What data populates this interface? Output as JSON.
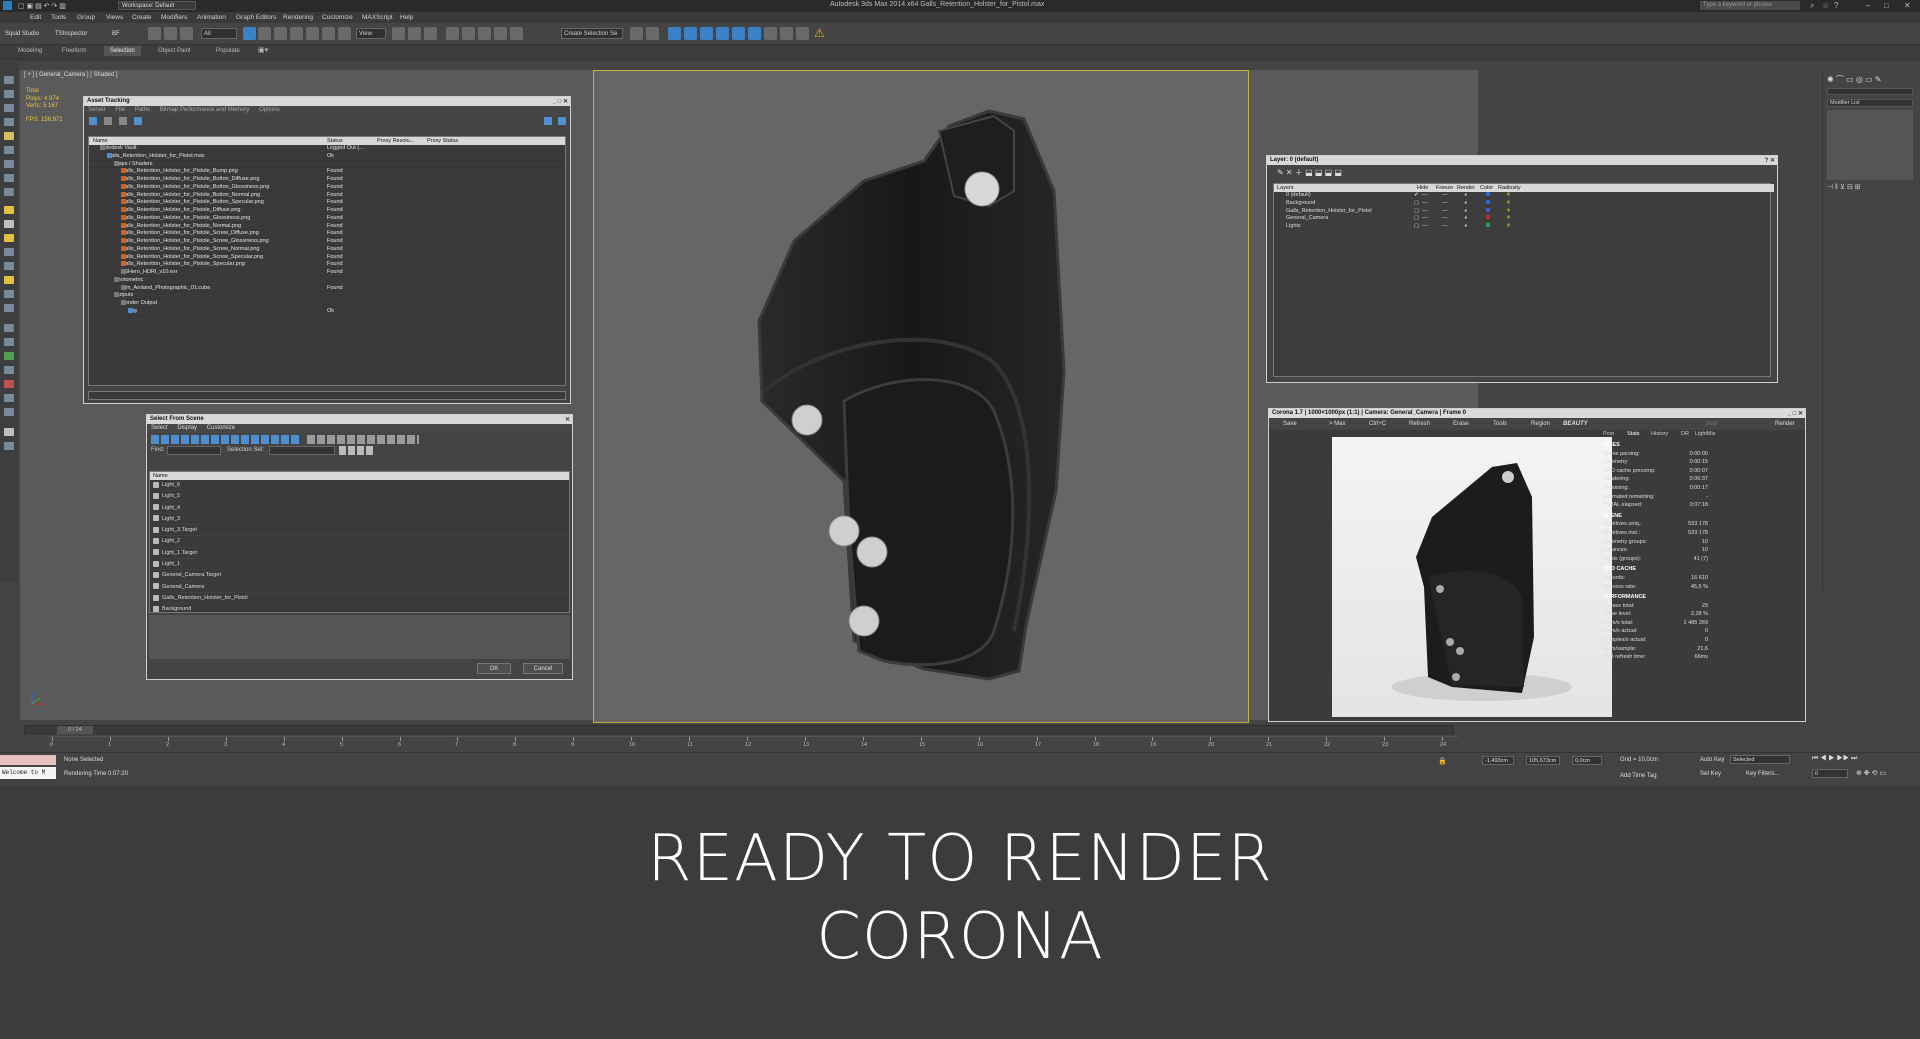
{
  "window": {
    "title": "Autodesk 3ds Max 2014 x64     Galls_Retention_Holster_for_Pistol.max",
    "workspace": "Workspace: Default",
    "search_placeholder": "Type a keyword or phrase"
  },
  "menubar": [
    "Edit",
    "Tools",
    "Group",
    "Views",
    "Create",
    "Modifiers",
    "Animation",
    "Graph Editors",
    "Rendering",
    "Customize",
    "MAXScript",
    "Help"
  ],
  "toolbar": {
    "left_labels": [
      "Squid Studio",
      "TSInspector",
      "BF"
    ],
    "filter_select": "All",
    "view_select": "View",
    "selection_set": "Create Selection Se"
  },
  "ribbon_tabs": [
    "Modeling",
    "Freeform",
    "Selection",
    "Object Paint",
    "Populate"
  ],
  "ribbon_active": "Selection",
  "viewport": {
    "label": "[ + ] [ General_Camera ] [ Shaded ]",
    "stats": {
      "total": "Total",
      "polys": "Polys:   4 974",
      "verts": "Verts:   5 167",
      "fps": "FPS:     156,971"
    }
  },
  "asset_tracking": {
    "title": "Asset Tracking",
    "menu": [
      "Server",
      "File",
      "Paths",
      "Bitmap Performance and Memory",
      "Options"
    ],
    "columns": [
      "Name",
      "Status",
      "Proxy Resolu...",
      "Proxy Status"
    ],
    "rows": [
      {
        "name": "Autodesk Vault",
        "status": "Logged Out (...",
        "indent": 1,
        "icon": "g"
      },
      {
        "name": "Galls_Retention_Holster_for_Pistol.max",
        "status": "Ok",
        "indent": 2,
        "icon": "b"
      },
      {
        "name": "Maps / Shaders",
        "status": "",
        "indent": 3,
        "icon": "g"
      },
      {
        "name": "Galls_Retention_Holster_for_Pistole_Bump.png",
        "status": "Found",
        "indent": 4,
        "icon": "o"
      },
      {
        "name": "Galls_Retention_Holster_for_Pistole_Button_Diffuse.png",
        "status": "Found",
        "indent": 4,
        "icon": "o"
      },
      {
        "name": "Galls_Retention_Holster_for_Pistole_Button_Glossiness.png",
        "status": "Found",
        "indent": 4,
        "icon": "o"
      },
      {
        "name": "Galls_Retention_Holster_for_Pistole_Button_Normal.png",
        "status": "Found",
        "indent": 4,
        "icon": "o"
      },
      {
        "name": "Galls_Retention_Holster_for_Pistole_Button_Specular.png",
        "status": "Found",
        "indent": 4,
        "icon": "o"
      },
      {
        "name": "Galls_Retention_Holster_for_Pistole_Diffuse.png",
        "status": "Found",
        "indent": 4,
        "icon": "o"
      },
      {
        "name": "Galls_Retention_Holster_for_Pistole_Glossiness.png",
        "status": "Found",
        "indent": 4,
        "icon": "o"
      },
      {
        "name": "Galls_Retention_Holster_for_Pistole_Normal.png",
        "status": "Found",
        "indent": 4,
        "icon": "o"
      },
      {
        "name": "Galls_Retention_Holster_for_Pistole_Screw_Diffuse.png",
        "status": "Found",
        "indent": 4,
        "icon": "o"
      },
      {
        "name": "Galls_Retention_Holster_for_Pistole_Screw_Glossiness.png",
        "status": "Found",
        "indent": 4,
        "icon": "o"
      },
      {
        "name": "Galls_Retention_Holster_for_Pistole_Screw_Normal.png",
        "status": "Found",
        "indent": 4,
        "icon": "o"
      },
      {
        "name": "Galls_Retention_Holster_for_Pistole_Screw_Specular.png",
        "status": "Found",
        "indent": 4,
        "icon": "o"
      },
      {
        "name": "Galls_Retention_Holster_for_Pistole_Specular.png",
        "status": "Found",
        "indent": 4,
        "icon": "o"
      },
      {
        "name": "TSHero_HDRI_v10.exr",
        "status": "Found",
        "indent": 4,
        "icon": "g"
      },
      {
        "name": "Photometric",
        "status": "",
        "indent": 3,
        "icon": "g"
      },
      {
        "name": "Kim_Amland_Photographic_01.cube",
        "status": "Found",
        "indent": 4,
        "icon": "g"
      },
      {
        "name": "Outputs",
        "status": "",
        "indent": 3,
        "icon": "g"
      },
      {
        "name": "Render Output",
        "status": "",
        "indent": 4,
        "icon": "g"
      },
      {
        "name": ".jpg",
        "status": "Ok",
        "indent": 5,
        "icon": "b"
      }
    ]
  },
  "select_from_scene": {
    "title": "Select From Scene",
    "menu": [
      "Select",
      "Display",
      "Customize"
    ],
    "find_label": "Find:",
    "selection_set_label": "Selection Set:",
    "column": "Name",
    "items": [
      "Light_6",
      "Light_5",
      "Light_4",
      "Light_3",
      "Light_3.Target",
      "Light_2",
      "Light_1.Target",
      "Light_1",
      "General_Camera.Target",
      "General_Camera",
      "Galls_Retention_Holster_for_Pistol",
      "Background"
    ],
    "ok": "OK",
    "cancel": "Cancel"
  },
  "layer_manager": {
    "title": "Layer: 0 (default)",
    "columns": [
      "Layers",
      "Hide",
      "Freeze",
      "Render",
      "Color",
      "Radiosity"
    ],
    "rows": [
      {
        "name": "0 (default)",
        "color": "#3060d0"
      },
      {
        "name": "Background",
        "color": "#3060d0"
      },
      {
        "name": "Galls_Retention_Holster_for_Pistol",
        "color": "#3060d0"
      },
      {
        "name": "General_Camera",
        "color": "#c03030"
      },
      {
        "name": "Lights",
        "color": "#30a050"
      }
    ]
  },
  "corona": {
    "title": "Corona 1.7 | 1000×1000px (1:1) | Camera: General_Camera | Frame 0",
    "toolbar": [
      "Save",
      "> Max",
      "Ctrl+C",
      "Refresh",
      "Erase",
      "Tools",
      "Region",
      "BEAUTY",
      "Stop",
      "Render"
    ],
    "tabs": [
      "Post",
      "Stats",
      "History",
      "DR",
      "LightMix"
    ],
    "sections": [
      {
        "header": "TIMES",
        "rows": [
          [
            "Scene parsing:",
            "0:00:00"
          ],
          [
            "Geometry:",
            "0:00:15"
          ],
          [
            "UHD cache precomp:",
            "0:00:07"
          ],
          [
            "Rendering:",
            "0:06:37"
          ],
          [
            "Denoising:",
            "0:00:17"
          ],
          [
            "Estimated remaining:",
            "-"
          ],
          [
            "TOTAL elapsed:",
            "0:07:18"
          ]
        ]
      },
      {
        "header": "SCENE",
        "rows": [
          [
            "Primitives uniq.:",
            "533 178"
          ],
          [
            "Primitives inst.:",
            "533 178"
          ],
          [
            "Geometry groups:",
            "10"
          ],
          [
            "Instances:",
            "10"
          ],
          [
            "Lights (groups):",
            "41 (7)"
          ]
        ]
      },
      {
        "header": "UHD CACHE",
        "rows": [
          [
            "Records:",
            "16 610"
          ],
          [
            "Success rate:",
            "45,5 %"
          ]
        ]
      },
      {
        "header": "PERFORMANCE",
        "rows": [
          [
            "Passes total:",
            "29"
          ],
          [
            "Noise level:",
            "2,28 %"
          ],
          [
            "Rays/s total:",
            "1 485 269"
          ],
          [
            "Rays/s actual:",
            "0"
          ],
          [
            "Samples/s actual:",
            "0"
          ],
          [
            "Rays/sample:",
            "21,6"
          ],
          [
            "VFB refresh time:",
            "66ms"
          ]
        ]
      }
    ]
  },
  "right_panel": {
    "modifier_list": "Modifier List"
  },
  "timeline": {
    "slider": "0 / 24",
    "ticks": [
      "0",
      "1",
      "2",
      "3",
      "4",
      "5",
      "6",
      "7",
      "8",
      "9",
      "10",
      "11",
      "12",
      "13",
      "14",
      "15",
      "16",
      "17",
      "18",
      "19",
      "20",
      "21",
      "22",
      "23",
      "24"
    ]
  },
  "statusbar": {
    "maxscript": "Welcome to M",
    "selection": "None Selected",
    "prompt": "Rendering Time  0:07:20",
    "x": "-1,493cm",
    "y": "105,673cm",
    "z": "0,0cm",
    "grid": "Grid = 10,0cm",
    "add_time_tag": "Add Time Tag",
    "auto_key": "Auto Key",
    "set_key": "Set Key",
    "selected": "Selected",
    "key_filters": "Key Filters...",
    "frame": "0"
  },
  "caption": {
    "line1": "READY TO RENDER",
    "line2": "CORONA"
  },
  "colors": {
    "viewport_frame": "#c8b040",
    "stats_yellow": "#e8c54a",
    "accent_blue": "#3b82c4"
  }
}
